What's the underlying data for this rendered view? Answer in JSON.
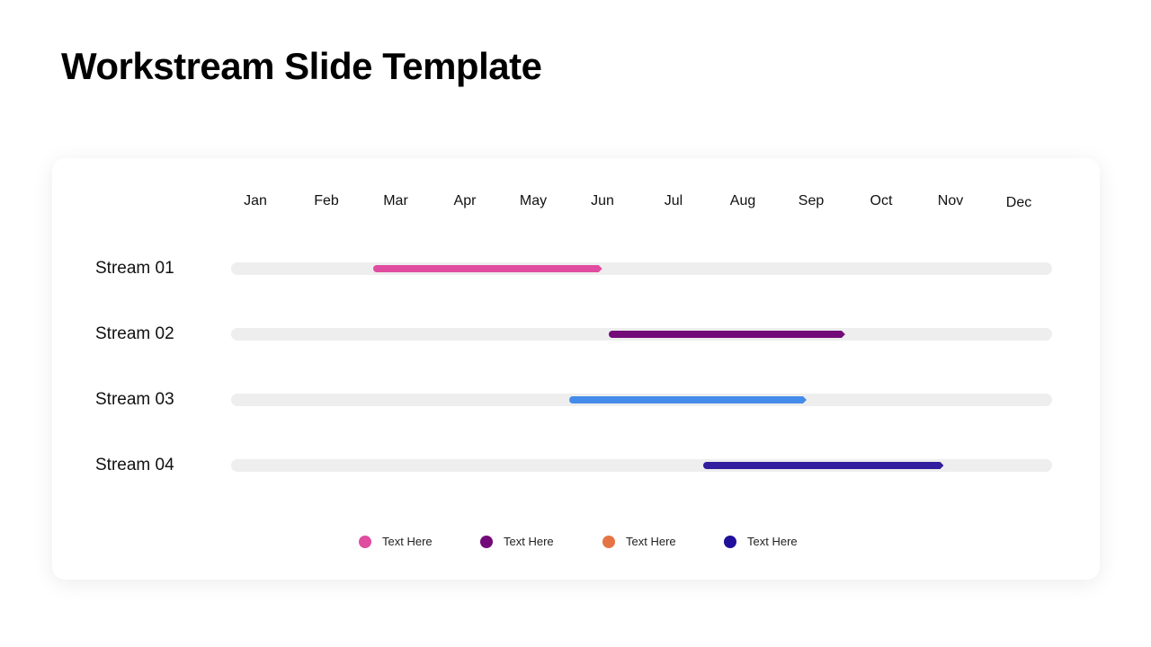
{
  "title": "Workstream Slide Template",
  "months": [
    "Jan",
    "Feb",
    "Mar",
    "Apr",
    "May",
    "Jun",
    "Jul",
    "Aug",
    "Sep",
    "Oct",
    "Nov",
    "Dec"
  ],
  "streams": [
    {
      "label": "Stream 01",
      "start": 0.173,
      "end": 0.452,
      "color": "#e04ca0"
    },
    {
      "label": "Stream 02",
      "start": 0.46,
      "end": 0.748,
      "color": "#730a78"
    },
    {
      "label": "Stream 03",
      "start": 0.412,
      "end": 0.701,
      "color": "#448bea"
    },
    {
      "label": "Stream 04",
      "start": 0.575,
      "end": 0.868,
      "color": "#321e9e"
    }
  ],
  "legend": [
    {
      "label": "Text Here",
      "color": "#e04ca0"
    },
    {
      "label": "Text Here",
      "color": "#730a78"
    },
    {
      "label": "Text Here",
      "color": "#e67344"
    },
    {
      "label": "Text Here",
      "color": "#21109a"
    }
  ]
}
